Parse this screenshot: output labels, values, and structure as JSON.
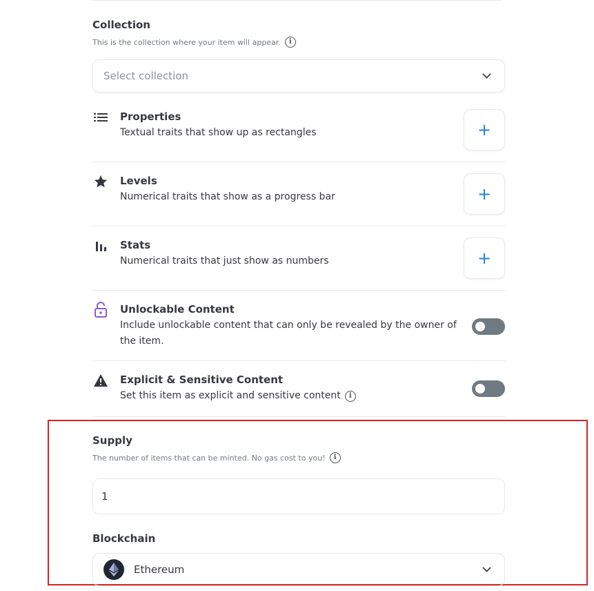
{
  "collection": {
    "title": "Collection",
    "subtitle": "This is the collection where your item will appear.",
    "select_placeholder": "Select collection"
  },
  "traits": [
    {
      "icon": "list-icon",
      "title": "Properties",
      "description": "Textual traits that show up as rectangles",
      "action": "+"
    },
    {
      "icon": "star-icon",
      "title": "Levels",
      "description": "Numerical traits that show as a progress bar",
      "action": "+"
    },
    {
      "icon": "bar-chart-icon",
      "title": "Stats",
      "description": "Numerical traits that just show as numbers",
      "action": "+"
    }
  ],
  "toggles": [
    {
      "icon": "lock-icon",
      "title": "Unlockable Content",
      "description": "Include unlockable content that can only be revealed by the owner of the item.",
      "enabled": false
    },
    {
      "icon": "warning-icon",
      "title": "Explicit & Sensitive Content",
      "description": "Set this item as explicit and sensitive content",
      "enabled": false
    }
  ],
  "supply": {
    "title": "Supply",
    "subtitle": "The number of items that can be minted. No gas cost to you!",
    "value": "1"
  },
  "blockchain": {
    "title": "Blockchain",
    "selected": "Ethereum"
  },
  "colors": {
    "accent": "#2081e2",
    "highlight": "#d62222",
    "toggle_off": "#707a83",
    "lock_icon": "#8b5ccf"
  }
}
